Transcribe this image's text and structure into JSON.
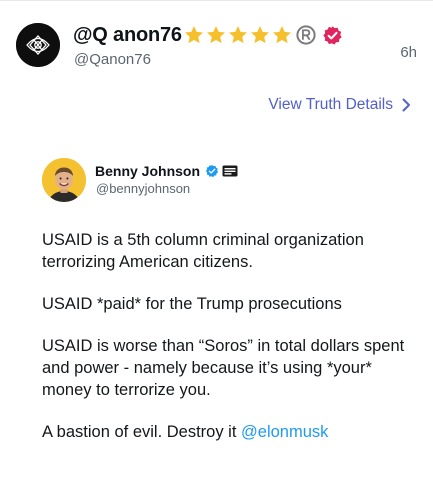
{
  "post": {
    "display_name": "@Q anon76",
    "handle": "@Qanon76",
    "timestamp": "6h",
    "badges": [
      "star-icon",
      "star-icon",
      "star-icon",
      "star-icon",
      "star-icon",
      "registered-icon",
      "verified-icon"
    ]
  },
  "actions": {
    "view_details_label": "View Truth Details"
  },
  "quoted": {
    "author_name": "Benny Johnson",
    "author_handle": "@bennyjohnson",
    "paragraphs": [
      "USAID is a 5th column criminal organization terrorizing American citizens.",
      "USAID *paid* for the Trump prosecutions",
      "USAID is worse than “Soros” in total dollars spent and power - namely because it’s using *your* money to terrorize you."
    ],
    "last_paragraph_text": "A bastion of evil. Destroy it ",
    "mention": "@elonmusk"
  },
  "colors": {
    "link": "#5360c8",
    "mention": "#1d9bf0",
    "verified": "#e0245e",
    "secondary_text": "#5b6670"
  }
}
